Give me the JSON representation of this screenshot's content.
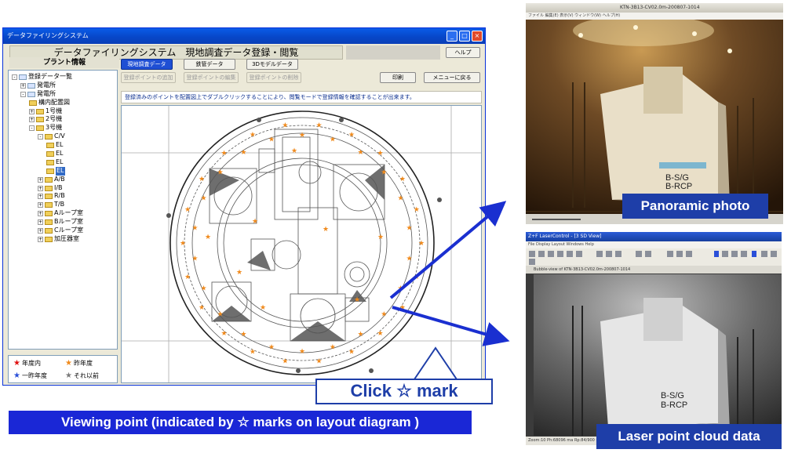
{
  "window": {
    "title": "データファイリングシステム",
    "controls": [
      "_",
      "□",
      "×"
    ],
    "app_title": "データファイリングシステム　現地調査データ登録・閲覧",
    "help_label": "ヘルプ",
    "plant_label": "プラント情報",
    "tabs": [
      "現地調査データ",
      "鉄管データ",
      "3Dモデルデータ"
    ],
    "point_buttons": [
      "登録ポイントの追加",
      "登録ポイントの編集",
      "登録ポイントの削除"
    ],
    "print_label": "印刷",
    "menu_label": "メニューに戻る",
    "hint": "登録済みのポイントを配置図上でダブルクリックすることにより、閲覧モードで登録情報を確認することが出来ます。"
  },
  "tree": [
    {
      "label": "登録データ一覧",
      "depth": 0,
      "expander": "-",
      "folder": false
    },
    {
      "label": "発電所",
      "depth": 1,
      "expander": "+",
      "folder": false
    },
    {
      "label": "発電所",
      "depth": 1,
      "expander": "-",
      "folder": false
    },
    {
      "label": "構内配置図",
      "depth": 2,
      "expander": "",
      "folder": true
    },
    {
      "label": "1号機",
      "depth": 2,
      "expander": "+",
      "folder": true
    },
    {
      "label": "2号機",
      "depth": 2,
      "expander": "+",
      "folder": true
    },
    {
      "label": "3号機",
      "depth": 2,
      "expander": "-",
      "folder": true
    },
    {
      "label": "C/V",
      "depth": 3,
      "expander": "-",
      "folder": true
    },
    {
      "label": "EL",
      "depth": 4,
      "expander": "",
      "folder": true
    },
    {
      "label": "EL",
      "depth": 4,
      "expander": "",
      "folder": true
    },
    {
      "label": "EL",
      "depth": 4,
      "expander": "",
      "folder": true
    },
    {
      "label": "EL",
      "depth": 4,
      "expander": "",
      "folder": true,
      "selected": true
    },
    {
      "label": "A/B",
      "depth": 3,
      "expander": "+",
      "folder": true
    },
    {
      "label": "I/B",
      "depth": 3,
      "expander": "+",
      "folder": true
    },
    {
      "label": "R/B",
      "depth": 3,
      "expander": "+",
      "folder": true
    },
    {
      "label": "T/B",
      "depth": 3,
      "expander": "+",
      "folder": true
    },
    {
      "label": "Aループ室",
      "depth": 3,
      "expander": "+",
      "folder": true
    },
    {
      "label": "Bループ室",
      "depth": 3,
      "expander": "+",
      "folder": true
    },
    {
      "label": "Cループ室",
      "depth": 3,
      "expander": "+",
      "folder": true
    },
    {
      "label": "加圧器室",
      "depth": 3,
      "expander": "+",
      "folder": true
    }
  ],
  "legend": [
    {
      "label": "年度内",
      "color": "#e01010"
    },
    {
      "label": "昨年度",
      "color": "#f08a1c"
    },
    {
      "label": "一昨年度",
      "color": "#2a4fd8"
    },
    {
      "label": "それ以前",
      "color": "#7a7a7a"
    }
  ],
  "photos": {
    "panoramic": {
      "window_title": "KTN-3B13-CV02.0m-200807-1014",
      "menu": "ファイル  編集(E)  表示(V)  ウィンドウ(W)  ヘルプ(H)",
      "sign_1": "B-S/G",
      "sign_2": "B-RCP",
      "caption": "Panoramic photo"
    },
    "laser": {
      "window_title": "Z+F LaserControl - [3 SD View]",
      "menu": "File  Display  Layout  Windows  Help",
      "tab": "Bubble-view of KTN-3B13-CV02.0m-200807-1014",
      "sign_1": "B-S/G",
      "sign_2": "B-RCP",
      "status": "Zoom:10        Ph:68096  ma            Rp:84/900 m        X/Y/Z:14/44 = 17/562 40,713 m",
      "caption": "Laser point cloud data"
    }
  },
  "annotations": {
    "click_label": "Click ☆ mark",
    "viewing_point": "Viewing point (indicated by ☆ marks on layout diagram )"
  },
  "colors": {
    "accent_blue": "#1e3ea8",
    "banner_blue": "#1a27d6",
    "titlebar_blue": "#0a5ce8",
    "star_orange": "#f08a1c"
  }
}
